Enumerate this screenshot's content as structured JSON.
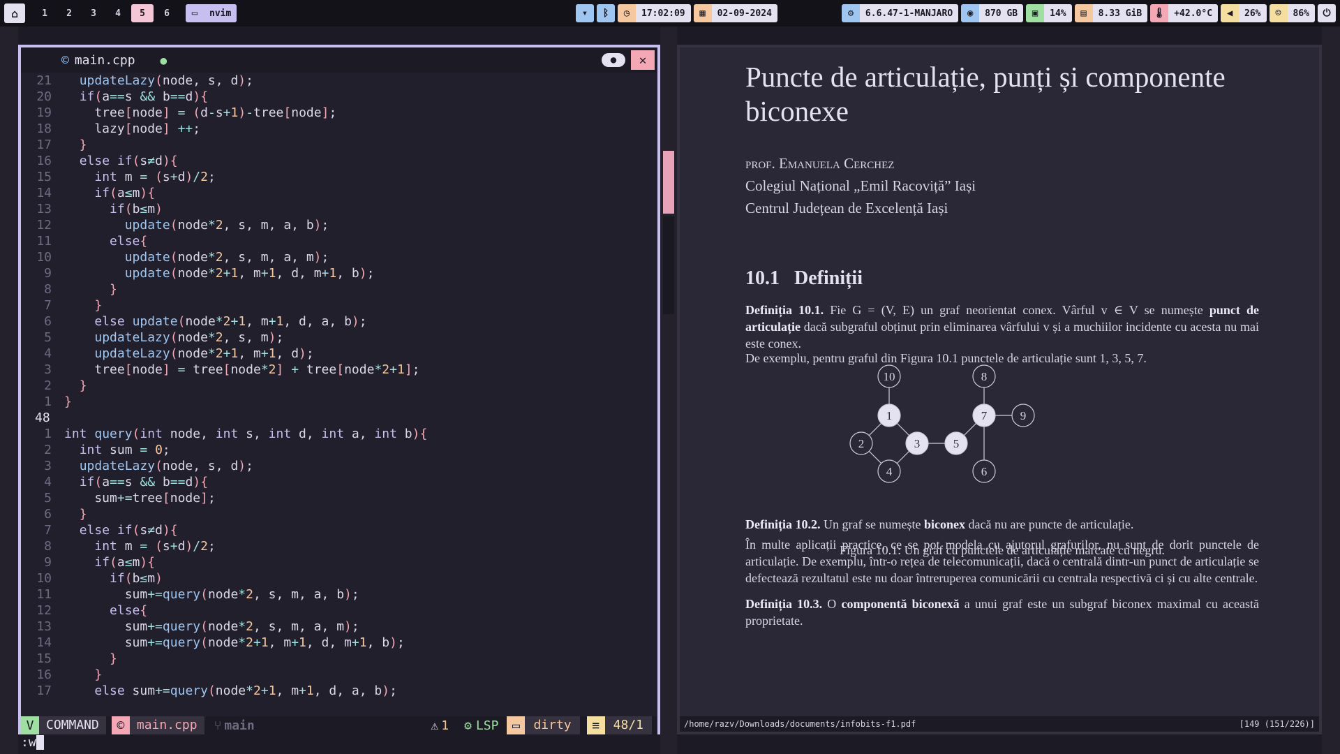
{
  "topbar": {
    "workspaces": [
      "1",
      "2",
      "3",
      "4",
      "5",
      "6"
    ],
    "active_workspace": "5",
    "window_title": "nvim",
    "clock": "17:02:09",
    "date": "02-09-2024",
    "kernel": "6.6.47-1-MANJARO",
    "disk": "870 GB",
    "cpu": "14%",
    "memory": "8.33 GiB",
    "temperature": "+42.0°C",
    "volume": "26%",
    "battery": "86%"
  },
  "editor": {
    "filename": "main.cpp",
    "code_lines": [
      {
        "n": "21",
        "t": "  updateLazy(node, s, d);"
      },
      {
        "n": "20",
        "t": "  if(a==s && b==d){"
      },
      {
        "n": "19",
        "t": "    tree[node] = (d-s+1)-tree[node];"
      },
      {
        "n": "18",
        "t": "    lazy[node] ++;"
      },
      {
        "n": "17",
        "t": "  }"
      },
      {
        "n": "16",
        "t": "  else if(s≠d){"
      },
      {
        "n": "15",
        "t": "    int m = (s+d)/2;"
      },
      {
        "n": "14",
        "t": "    if(a≤m){"
      },
      {
        "n": "13",
        "t": "      if(b≤m)"
      },
      {
        "n": "12",
        "t": "        update(node*2, s, m, a, b);"
      },
      {
        "n": "11",
        "t": "      else{"
      },
      {
        "n": "10",
        "t": "        update(node*2, s, m, a, m);"
      },
      {
        "n": "9",
        "t": "        update(node*2+1, m+1, d, m+1, b);"
      },
      {
        "n": "8",
        "t": "      }"
      },
      {
        "n": "7",
        "t": "    }"
      },
      {
        "n": "6",
        "t": "    else update(node*2+1, m+1, d, a, b);"
      },
      {
        "n": "5",
        "t": "    updateLazy(node*2, s, m);"
      },
      {
        "n": "4",
        "t": "    updateLazy(node*2+1, m+1, d);"
      },
      {
        "n": "3",
        "t": "    tree[node] = tree[node*2] + tree[node*2+1];"
      },
      {
        "n": "2",
        "t": "  }"
      },
      {
        "n": "1",
        "t": "}"
      },
      {
        "n": "48",
        "t": "",
        "cur": true
      },
      {
        "n": "1",
        "t": "int query(int node, int s, int d, int a, int b){"
      },
      {
        "n": "2",
        "t": "  int sum = 0;"
      },
      {
        "n": "3",
        "t": "  updateLazy(node, s, d);"
      },
      {
        "n": "4",
        "t": "  if(a==s && b==d){"
      },
      {
        "n": "5",
        "t": "    sum+=tree[node];"
      },
      {
        "n": "6",
        "t": "  }"
      },
      {
        "n": "7",
        "t": "  else if(s≠d){"
      },
      {
        "n": "8",
        "t": "    int m = (s+d)/2;"
      },
      {
        "n": "9",
        "t": "    if(a≤m){"
      },
      {
        "n": "10",
        "t": "      if(b≤m)"
      },
      {
        "n": "11",
        "t": "        sum+=query(node*2, s, m, a, b);"
      },
      {
        "n": "12",
        "t": "      else{"
      },
      {
        "n": "13",
        "t": "        sum+=query(node*2, s, m, a, m);"
      },
      {
        "n": "14",
        "t": "        sum+=query(node*2+1, m+1, d, m+1, b);"
      },
      {
        "n": "15",
        "t": "      }"
      },
      {
        "n": "16",
        "t": "    }"
      },
      {
        "n": "17",
        "t": "    else sum+=query(node*2+1, m+1, d, a, b);"
      }
    ],
    "status": {
      "mode": "COMMAND",
      "file": "main.cpp",
      "branch": "main",
      "warnings": "1",
      "lsp": "LSP",
      "git_state": "dirty",
      "position": "48/1"
    },
    "command_line": ":w"
  },
  "pdf": {
    "title": "Puncte de articulație, punți și componente biconexe",
    "author_name": "prof. Emanuela Cerchez",
    "affiliation1": "Colegiul Național „Emil Racoviță” Iași",
    "affiliation2": "Centrul Județean de Excelență Iași",
    "section": "10.1   Definiții",
    "def1_label": "Definiția 10.1.",
    "def1_text_a": " Fie G = (V, E) un graf neorientat conex. Vârful v ∈ V se numește ",
    "def1_bold": "punct de articulație",
    "def1_text_b": " dacă subgraful obținut prin eliminarea vârfului v și a muchiilor incidente cu acesta nu mai este conex.",
    "example": "De exemplu, pentru graful din Figura 10.1 punctele de articulație sunt 1, 3, 5, 7.",
    "graph_nodes": [
      "10",
      "1",
      "2",
      "3",
      "4",
      "5",
      "7",
      "8",
      "9",
      "6"
    ],
    "caption": "Figura 10.1: Un graf cu punctele de articulație marcate cu negru.",
    "def2_label": "Definiția 10.2.",
    "def2_text_a": " Un graf se numește ",
    "def2_bold": "biconex",
    "def2_text_b": " dacă nu are puncte de articulație.",
    "para_apps": "În multe aplicații practice, ce se pot modela cu ajutorul grafurilor, nu sunt de dorit punctele de articulație. De exemplu, într-o rețea de telecomunicații, dacă o centrală dintr-un punct de articulație se defectează rezultatul este nu doar întreruperea comunicării cu centrala respectivă ci și cu alte centrale.",
    "def3_label": "Definiția 10.3.",
    "def3_text_a": " O ",
    "def3_bold": "componentă biconexă",
    "def3_text_b": " a unui graf este un subgraf biconex maximal cu această proprietate.",
    "path": "/home/razv/Downloads/documents/infobits-f1.pdf",
    "page": "[149 (151/226)]"
  }
}
